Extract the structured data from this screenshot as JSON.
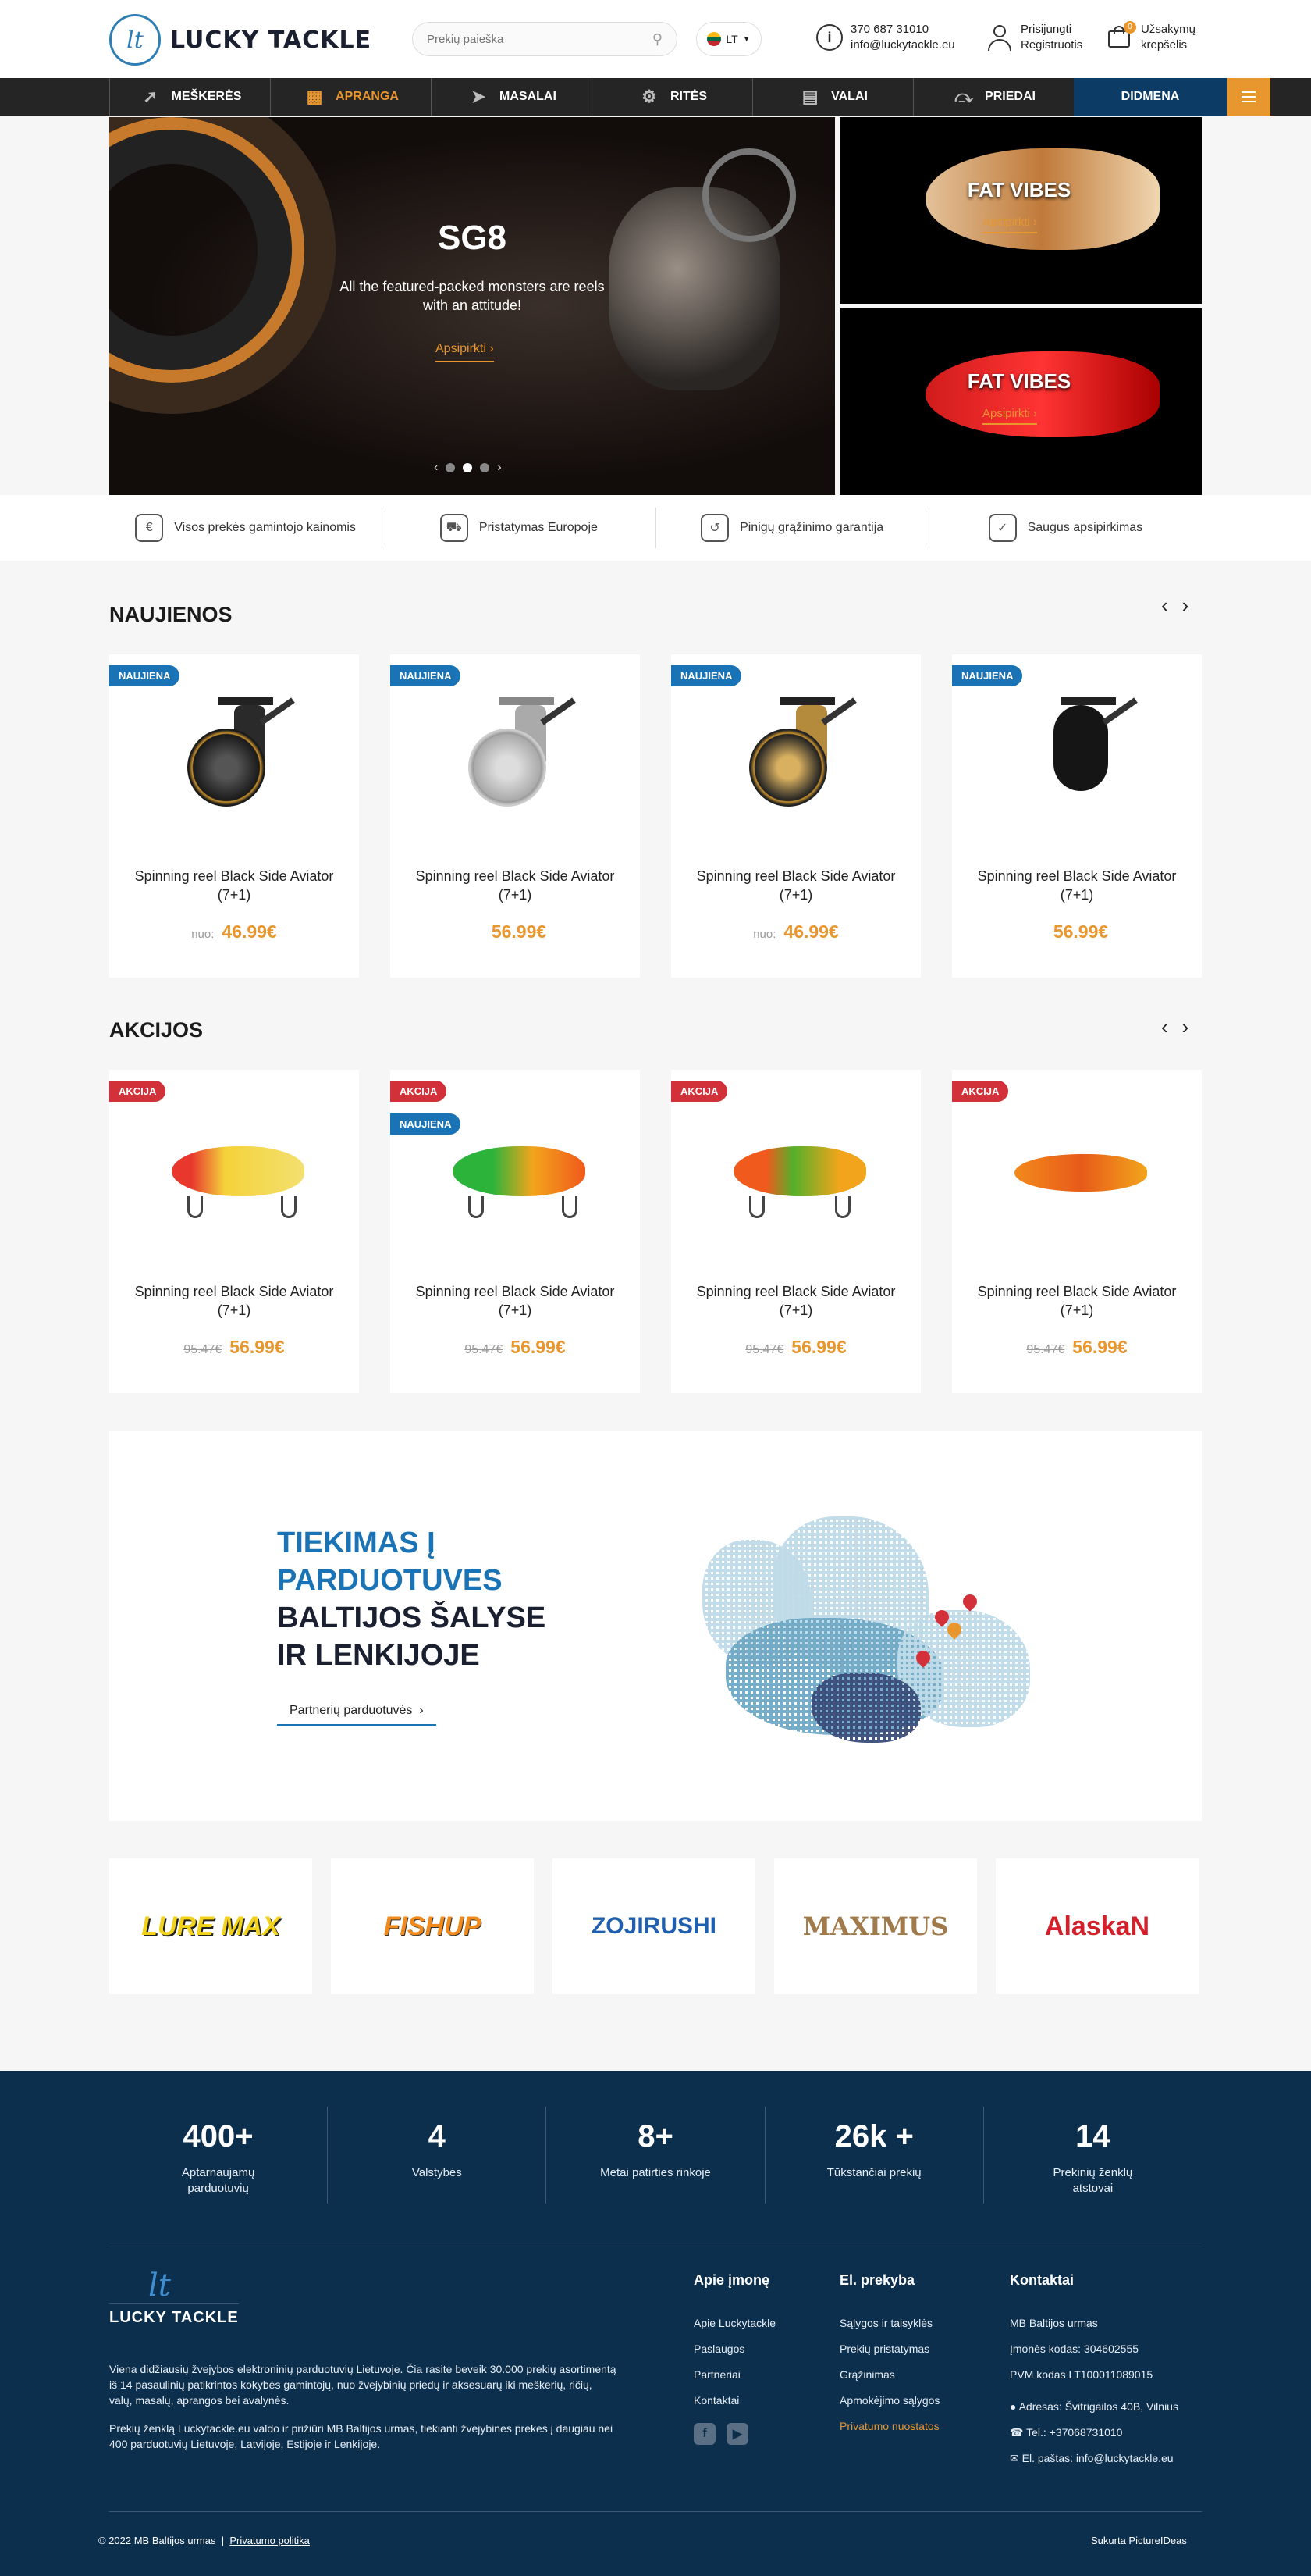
{
  "header": {
    "logo_text": "LUCKY TACKLE",
    "search_placeholder": "Prekių paieška",
    "lang": "LT",
    "phone": "370 687 31010",
    "email": "info@luckytackle.eu",
    "login": "Prisijungti",
    "register": "Registruotis",
    "cart_count": "0",
    "cart_line1": "Užsakymų",
    "cart_line2": "krepšelis"
  },
  "nav": {
    "items": [
      {
        "label": "MEŠKERĖS",
        "icon": "rod-icon"
      },
      {
        "label": "APRANGA",
        "icon": "vest-icon"
      },
      {
        "label": "MASALAI",
        "icon": "lure-icon"
      },
      {
        "label": "RITĖS",
        "icon": "reel-icon"
      },
      {
        "label": "VALAI",
        "icon": "line-icon"
      },
      {
        "label": "PRIEDAI",
        "icon": "hook-icon"
      }
    ],
    "wholesale": "DIDMENA",
    "accent": "#e8962e",
    "wholesale_color": "#0c3c66"
  },
  "hero": {
    "title": "SG8",
    "subtitle": "All the featured-packed monsters are reels with an attitude!",
    "button": "Apsipirkti",
    "slides": 3,
    "active_slide": 2
  },
  "side_banners": [
    {
      "title": "FAT VIBES",
      "button": "Apsipirkti"
    },
    {
      "title": "FAT VIBES",
      "button": "Apsipirkti"
    }
  ],
  "usp": [
    {
      "label": "Visos prekės gamintojo kainomis",
      "icon": "price-hand-icon"
    },
    {
      "label": "Pristatymas Europoje",
      "icon": "truck-icon"
    },
    {
      "label": "Pinigų grąžinimo garantija",
      "icon": "money-back-icon"
    },
    {
      "label": "Saugus apsipirkimas",
      "icon": "shield-icon"
    }
  ],
  "new_section": {
    "title": "NAUJIENOS",
    "products": [
      {
        "badge": "NAUJIENA",
        "name": "Spinning reel Black Side Aviator (7+1)",
        "from": "nuo:",
        "price": "46.99€"
      },
      {
        "badge": "NAUJIENA",
        "name": "Spinning reel Black Side Aviator (7+1)",
        "from": "",
        "price": "56.99€"
      },
      {
        "badge": "NAUJIENA",
        "name": "Spinning reel Black Side Aviator (7+1)",
        "from": "nuo:",
        "price": "46.99€"
      },
      {
        "badge": "NAUJIENA",
        "name": "Spinning reel Black Side Aviator (7+1)",
        "from": "",
        "price": "56.99€"
      }
    ]
  },
  "sale_section": {
    "title": "AKCIJOS",
    "products": [
      {
        "badge": "AKCIJA",
        "badge2": "",
        "name": "Spinning reel Black Side Aviator (7+1)",
        "old_price": "95.47€",
        "price": "56.99€"
      },
      {
        "badge": "AKCIJA",
        "badge2": "NAUJIENA",
        "name": "Spinning reel Black Side Aviator (7+1)",
        "old_price": "95.47€",
        "price": "56.99€"
      },
      {
        "badge": "AKCIJA",
        "badge2": "",
        "name": "Spinning reel Black Side Aviator (7+1)",
        "old_price": "95.47€",
        "price": "56.99€"
      },
      {
        "badge": "AKCIJA",
        "badge2": "",
        "name": "Spinning reel Black Side Aviator (7+1)",
        "old_price": "95.47€",
        "price": "56.99€"
      }
    ]
  },
  "supply": {
    "line1": "TIEKIMAS Į",
    "line2": "PARDUOTUVES",
    "line3": "BALTIJOS ŠALYSE",
    "line4": "IR LENKIJOJE",
    "button": "Partnerių parduotuvės"
  },
  "brands": [
    {
      "name": "LURE MAX",
      "color": "#f2d21b"
    },
    {
      "name": "FISHUP",
      "color": "#f08a1c"
    },
    {
      "name": "ZOJIRUSHI",
      "color": "#1f5fae"
    },
    {
      "name": "MAXIMUS",
      "color": "#a07a4a"
    },
    {
      "name": "AlaskaN",
      "color": "#d3202a"
    }
  ],
  "stats": [
    {
      "num": "400+",
      "label": "Aptarnaujamų parduotuvių"
    },
    {
      "num": "4",
      "label": "Valstybės"
    },
    {
      "num": "8+",
      "label": "Metai patirties rinkoje"
    },
    {
      "num": "26k +",
      "label": "Tūkstančiai prekių"
    },
    {
      "num": "14",
      "label": "Prekinių ženklų atstovai"
    }
  ],
  "footer": {
    "logo_text": "LUCKY TACKLE",
    "about1": "Viena didžiausių žvejybos elektroninių parduotuvių Lietuvoje. Čia rasite beveik 30.000 prekių asortimentą iš 14 pasaulinių patikrintos kokybės gamintojų, nuo žvejybinių priedų ir aksesuarų iki meškerių, ričių, valų, masalų, aprangos bei avalynės.",
    "about2": "Prekių ženklą Luckytackle.eu valdo ir prižiūri MB Baltijos urmas, tiekianti žvejybines prekes į daugiau nei 400 parduotuvių Lietuvoje, Latvijoje, Estijoje ir Lenkijoje.",
    "col1": {
      "title": "Apie įmonę",
      "items": [
        "Apie Luckytackle",
        "Paslaugos",
        "Partneriai",
        "Kontaktai"
      ]
    },
    "col2": {
      "title": "El. prekyba",
      "items": [
        "Sąlygos ir taisyklės",
        "Prekių pristatymas",
        "Grąžinimas",
        "Apmokėjimo sąlygos",
        "Privatumo nuostatos"
      ]
    },
    "col3": {
      "title": "Kontaktai",
      "company": "MB Baltijos urmas",
      "code": "Įmonės kodas: 304602555",
      "vat": "PVM kodas LT100011089015",
      "address": "Adresas: Švitrigailos 40B, Vilnius",
      "phone": "Tel.: +37068731010",
      "email": "El. paštas: info@luckytackle.eu"
    },
    "copyright": "© 2022 MB Baltijos urmas",
    "privacy": "Privatumo politika",
    "credit": "Sukurta PictureIDeas"
  }
}
